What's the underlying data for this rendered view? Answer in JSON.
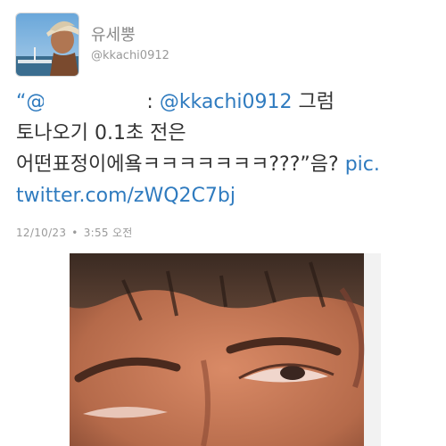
{
  "user": {
    "display_name": "유세뿡",
    "handle": "@kkachi0912"
  },
  "tweet": {
    "open_quote": "“@",
    "redacted_mention": "",
    "colon": " : ",
    "mention": "@kkachi0912",
    "line1_rest": " 그럼",
    "line2": "토나오기 0.1초 전은",
    "line3_text": "어떤표정이에욬ㅋㅋㅋㅋㅋㅋㅋ???”음? ",
    "link_part1": "pic.",
    "link_part2": "twitter.com/zWQ2C7bj"
  },
  "meta": {
    "date": "12/10/23",
    "separator": "•",
    "time": "3:55 오전"
  },
  "colors": {
    "link": "#2f7bbf",
    "text": "#333333",
    "muted": "#9a9a9a"
  },
  "icons": {
    "avatar": "profile-photo",
    "media": "attached-photo"
  }
}
